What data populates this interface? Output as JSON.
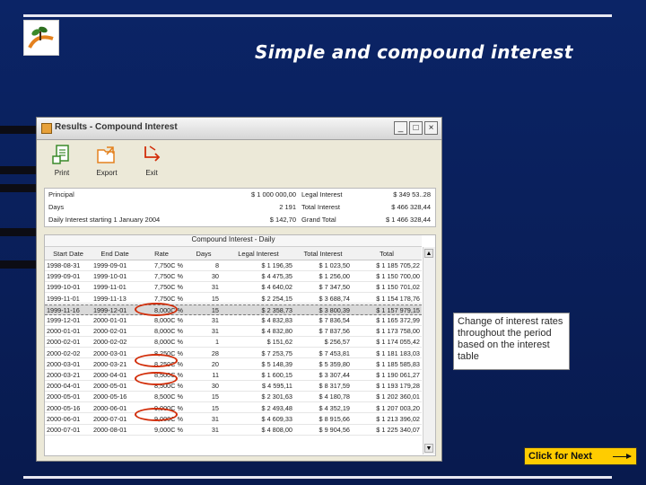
{
  "slide": {
    "title": "Simple and compound interest",
    "callout": "Change of interest rates throughout the period based on the interest table",
    "next_button": "Click for Next"
  },
  "window": {
    "title": "Results - Compound Interest",
    "controls": [
      "_",
      "□",
      "×"
    ]
  },
  "toolbar": {
    "items": [
      {
        "label": "Print",
        "icon": "print-icon"
      },
      {
        "label": "Export",
        "icon": "export-icon"
      },
      {
        "label": "Exit",
        "icon": "exit-icon"
      }
    ]
  },
  "summary": {
    "principal_label": "Principal",
    "principal_value": "$ 1 000 000,00",
    "legal_interest_label": "Legal Interest",
    "legal_interest_value": "$ 349 53..28",
    "days_label": "Days",
    "days_value": "2 191",
    "total_interest_label": "Total Interest",
    "total_interest_value": "$ 466 328,44",
    "daily_label": "Daily Interest starting 1 January 2004",
    "daily_value": "$ 142,70",
    "grand_total_label": "Grand Total",
    "grand_total_value": "$ 1 466 328,44"
  },
  "table": {
    "caption": "Compound Interest - Daily",
    "headers": [
      "Start Date",
      "End Date",
      "Rate",
      "Days",
      "Legal Interest",
      "Total Interest",
      "Total"
    ],
    "rows": [
      [
        "1998-08-31",
        "1999-09-01",
        "7,750C %",
        "8",
        "$ 1 196,35",
        "$ 1 023,50",
        "$ 1 185 705,22"
      ],
      [
        "1999-09-01",
        "1999-10-01",
        "7,750C %",
        "30",
        "$ 4 475,35",
        "$ 1 256,00",
        "$ 1 150 700,00"
      ],
      [
        "1999-10-01",
        "1999-11-01",
        "7,750C %",
        "31",
        "$ 4 640,02",
        "$ 7 347,50",
        "$ 1 150 701,02"
      ],
      [
        "1999-11-01",
        "1999-11-13",
        "7,750C %",
        "15",
        "$ 2 254,15",
        "$ 3 688,74",
        "$ 1 154 178,76"
      ],
      [
        "1999-11-16",
        "1999-12-01",
        "8,000C %",
        "15",
        "$ 2 358,73",
        "$ 3 800,39",
        "$ 1 157 979,15"
      ],
      [
        "1999-12-01",
        "2000-01-01",
        "8,000C %",
        "31",
        "$ 4 832,83",
        "$ 7 836,54",
        "$ 1 165 372,99"
      ],
      [
        "2000-01-01",
        "2000-02-01",
        "8,000C %",
        "31",
        "$ 4 832,80",
        "$ 7 837,56",
        "$ 1 173 758,00"
      ],
      [
        "2000-02-01",
        "2000-02-02",
        "8,000C %",
        "1",
        "$ 151,62",
        "$ 256,57",
        "$ 1 174 055,42"
      ],
      [
        "2000-02-02",
        "2000-03-01",
        "8,250C %",
        "28",
        "$ 7 253,75",
        "$ 7 453,81",
        "$ 1 181 183,03"
      ],
      [
        "2000-03-01",
        "2000-03-21",
        "8,250C %",
        "20",
        "$ 5 148,39",
        "$ 5 359,80",
        "$ 1 185 585,83"
      ],
      [
        "2000-03-21",
        "2000-04-01",
        "8,500C %",
        "11",
        "$ 1 600,15",
        "$ 3 307,44",
        "$ 1 190 061,27"
      ],
      [
        "2000-04-01",
        "2000-05-01",
        "8,500C %",
        "30",
        "$ 4 595,11",
        "$ 8 317,59",
        "$ 1 193 179,28"
      ],
      [
        "2000-05-01",
        "2000-05-16",
        "8,500C %",
        "15",
        "$ 2 301,63",
        "$ 4 180,78",
        "$ 1 202 360,01"
      ],
      [
        "2000-05-16",
        "2000-06-01",
        "9,000C %",
        "15",
        "$ 2 493,48",
        "$ 4 352,19",
        "$ 1 207 003,20"
      ],
      [
        "2000-06-01",
        "2000-07-01",
        "9,000C %",
        "31",
        "$ 4 609,33",
        "$ 8 915,66",
        "$ 1 213 396,02"
      ],
      [
        "2000-07-01",
        "2000-08-01",
        "9,000C %",
        "31",
        "$ 4 808,00",
        "$ 9 904,56",
        "$ 1 225 340,07"
      ]
    ]
  }
}
